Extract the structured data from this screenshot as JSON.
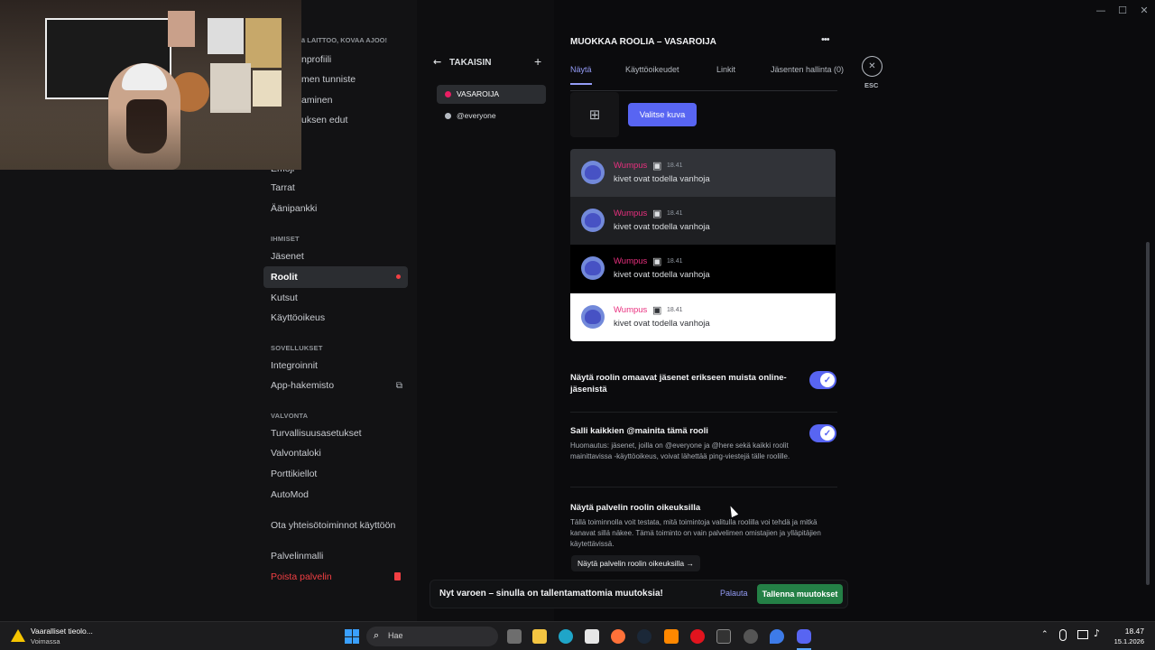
{
  "window": {
    "minimize": "—",
    "maximize": "☐",
    "close": "✕"
  },
  "sidebar": {
    "cut_items": [
      {
        "name": "side-item-cut-1",
        "label": "ä LAITTOO, KOVAA AJOO!"
      },
      {
        "name": "side-item-cut-2",
        "label": "nprofiili"
      },
      {
        "name": "side-item-cut-3",
        "label": "men tunniste"
      },
      {
        "name": "side-item-cut-4",
        "label": "aminen"
      },
      {
        "name": "side-item-cut-5",
        "label": "uksen edut"
      },
      {
        "name": "side-item-cut-6",
        "label": "Emoji"
      }
    ],
    "items": [
      {
        "name": "sidebar-item-tarrat",
        "label": "Tarrat"
      },
      {
        "name": "sidebar-item-aanipankki",
        "label": "Äänipankki"
      },
      {
        "name": "sidebar-item-jasenet",
        "label": "Jäsenet"
      },
      {
        "name": "sidebar-item-roolit",
        "label": "Roolit"
      },
      {
        "name": "sidebar-item-kutsut",
        "label": "Kutsut"
      },
      {
        "name": "sidebar-item-kayttooikeus",
        "label": "Käyttöoikeus"
      },
      {
        "name": "sidebar-item-integroinnit",
        "label": "Integroinnit"
      },
      {
        "name": "sidebar-item-app-hakemisto",
        "label": "App-hakemisto"
      },
      {
        "name": "sidebar-item-turvallisuusasetukset",
        "label": "Turvallisuusasetukset"
      },
      {
        "name": "sidebar-item-valvontaloki",
        "label": "Valvontaloki"
      },
      {
        "name": "sidebar-item-porttikiellot",
        "label": "Porttikiellot"
      },
      {
        "name": "sidebar-item-automod",
        "label": "AutoMod"
      },
      {
        "name": "sidebar-item-yhteisotoiminnot",
        "label": "Ota yhteisötoiminnot käyttöön"
      },
      {
        "name": "sidebar-item-palvelinmalli",
        "label": "Palvelinmalli"
      },
      {
        "name": "sidebar-item-poista-palvelin",
        "label": "Poista palvelin"
      }
    ],
    "headings": {
      "ihmiset": "IHMISET",
      "sovellukset": "SOVELLUKSET",
      "valvonta": "VALVONTA"
    }
  },
  "roles": {
    "back_label": "TAKAISIN",
    "add": "+",
    "list": [
      {
        "label": "VASAROIJA",
        "color": "#e91e63"
      },
      {
        "label": "@everyone",
        "color": "#b5bac1"
      }
    ]
  },
  "header": {
    "title": "MUOKKAA ROOLIA – VASAROIJA",
    "more": "•••",
    "esc": "ESC",
    "tabs": [
      "Näytä",
      "Käyttöoikeudet",
      "Linkit",
      "Jäsenten hallinta (0)"
    ]
  },
  "icon_section": {
    "button": "Valitse kuva"
  },
  "previews": [
    {
      "bg": "#313338",
      "text": "#dbdee1"
    },
    {
      "bg": "#1e1f22",
      "text": "#dbdee1"
    },
    {
      "bg": "#000000",
      "text": "#dbdee1"
    },
    {
      "bg": "#ffffff",
      "text": "#313338"
    }
  ],
  "preview_msg": {
    "user": "Wumpus",
    "time": "18.41",
    "text": "kivet ovat todella vanhoja"
  },
  "settings": [
    {
      "title": "Näytä roolin omaavat jäsenet erikseen muista online-jäsenistä",
      "enabled": true
    },
    {
      "title": "Salli kaikkien @mainita tämä rooli",
      "desc": "Huomautus: jäsenet, joilla on @everyone ja @here sekä kaikki roolit mainittavissa -käyttöoikeus, voivat lähettää ping-viestejä tälle roolille.",
      "enabled": true
    }
  ],
  "view_as": {
    "title": "Näytä palvelin roolin oikeuksilla",
    "desc": "Tällä toiminnolla voit testata, mitä toimintoja valitulla roolilla voi tehdä ja mitkä kanavat sillä näkee. Tämä toiminto on vain palvelimen omistajien ja ylläpitäjien käytettävissä.",
    "button": "Näytä palvelin roolin oikeuksilla →"
  },
  "save_bar": {
    "message": "Nyt varoen – sinulla on tallentamattomia muutoksia!",
    "reset": "Palauta",
    "save": "Tallenna muutokset"
  },
  "taskbar": {
    "warning_title": "Vaaralliset tieolo...",
    "warning_sub": "Voimassa",
    "search": "Hae",
    "time": "18.47",
    "date": "15.1.2026"
  },
  "colors": {
    "accent": "#5865f2",
    "role": "#e91e63",
    "save": "#248046",
    "danger": "#f23f43"
  }
}
